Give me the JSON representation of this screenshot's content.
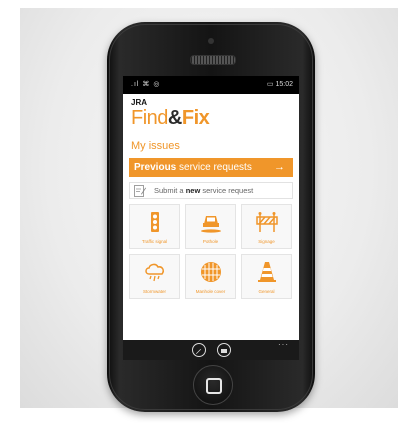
{
  "status": {
    "signal": ".ıl",
    "icons": "⌘ ◎",
    "battery_time": "▭ 15:02"
  },
  "brand": {
    "org": "JRA",
    "find": "Find",
    "amp": "&",
    "fix": "Fix"
  },
  "section_title": "My issues",
  "previous": {
    "bold": "Previous",
    "rest": " service requests",
    "arrow": "→"
  },
  "submit": {
    "pre": "Submit a ",
    "bold": "new",
    "post": " service request"
  },
  "categories": [
    {
      "label": "Traffic signal"
    },
    {
      "label": "Pothole"
    },
    {
      "label": "Signage"
    },
    {
      "label": "Stormwater"
    },
    {
      "label": "Manhole cover"
    },
    {
      "label": "General"
    }
  ],
  "nav": {
    "dots": "···"
  },
  "colors": {
    "accent": "#f0962a",
    "dark": "#2b2b2b"
  }
}
